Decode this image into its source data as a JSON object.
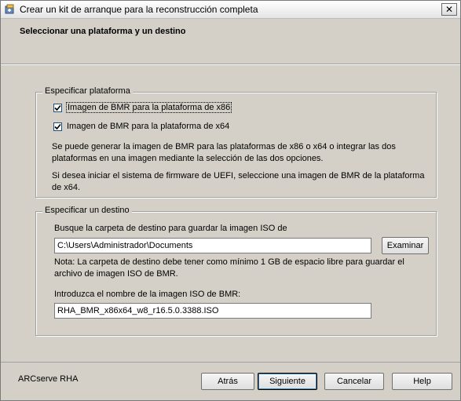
{
  "window": {
    "title": "Crear un kit de arranque para la reconstrucción completa",
    "close_glyph": "✕"
  },
  "header": {
    "title": "Seleccionar una plataforma y un destino"
  },
  "platform_group": {
    "legend": "Especificar plataforma",
    "options": [
      {
        "label": "Imagen de BMR para la plataforma de x86",
        "checked": true
      },
      {
        "label": "Imagen de BMR para la plataforma de x64",
        "checked": true
      }
    ],
    "info_1": "Se puede generar la imagen de BMR para las plataformas de x86 o x64 o integrar las dos plataformas en una imagen mediante la selección de las dos opciones.",
    "info_2": "Si desea iniciar el sistema de firmware de UEFI, seleccione una imagen de BMR de la plataforma de x64."
  },
  "destination_group": {
    "legend": "Especificar un destino",
    "folder_prompt": "Busque la carpeta de destino para guardar la imagen ISO de",
    "folder_value": "C:\\Users\\Administrador\\Documents",
    "browse_label": "Examinar",
    "note": "Nota: La carpeta de destino debe tener como mínimo 1 GB de espacio libre para guardar el archivo de imagen ISO de BMR.",
    "iso_prompt": "Introduzca el nombre de la imagen ISO de BMR:",
    "iso_value": "RHA_BMR_x86x64_w8_r16.5.0.3388.ISO"
  },
  "footer": {
    "brand": "ARCserve RHA",
    "buttons": {
      "back": "Atrás",
      "next": "Siguiente",
      "cancel": "Cancelar",
      "help": "Help"
    }
  },
  "icons": {
    "app": "app-icon",
    "close": "close-icon",
    "checkbox": "checkmark-icon"
  }
}
